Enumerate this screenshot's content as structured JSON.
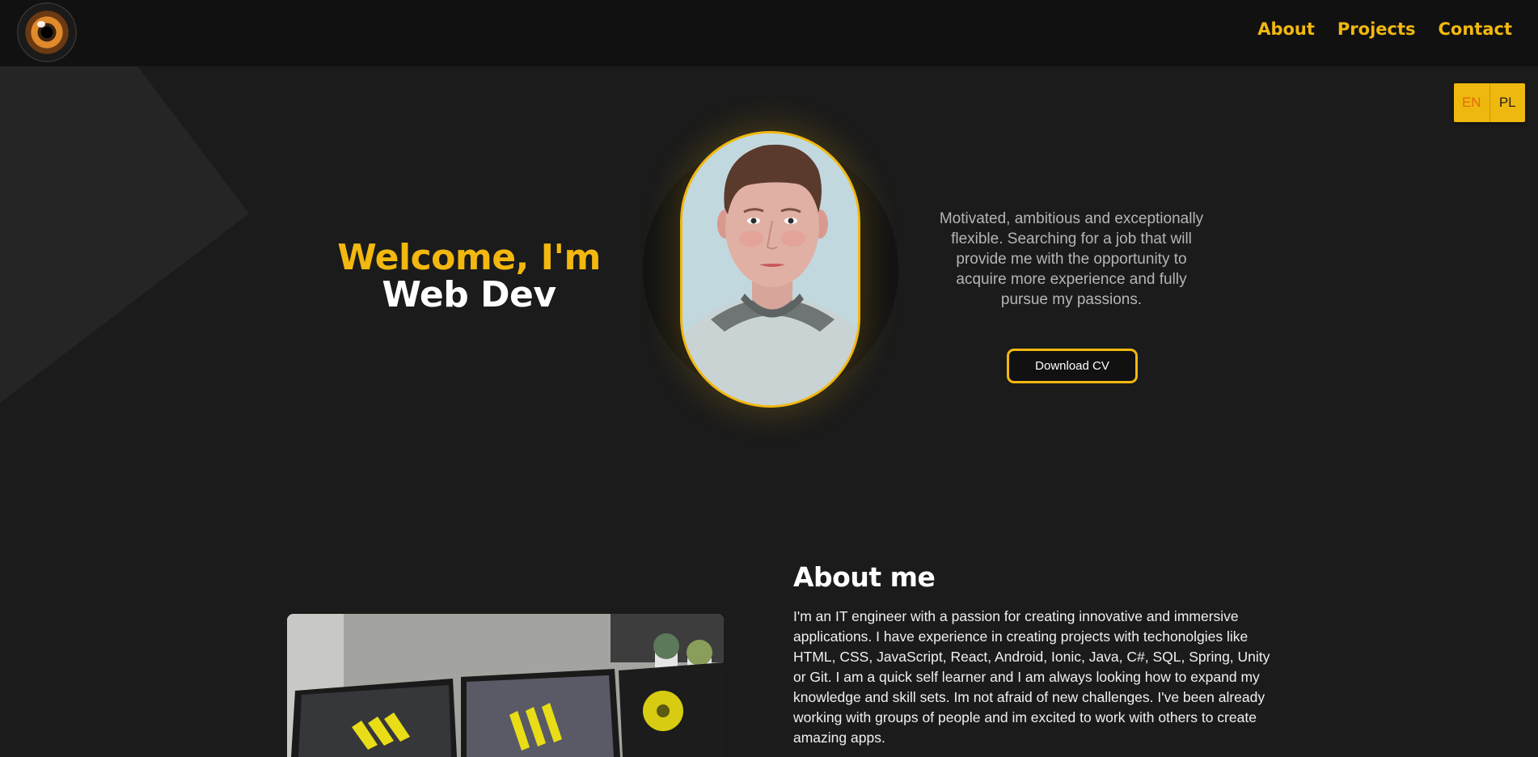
{
  "nav": {
    "items": [
      "About",
      "Projects",
      "Contact"
    ]
  },
  "lang": {
    "en": "EN",
    "pl": "PL"
  },
  "hero": {
    "line1": "Welcome, I'm",
    "line2": "Web Dev",
    "intro": "Motivated, ambitious and exceptionally flexible. Searching for a job that will provide me with the opportunity to acquire more experience and fully pursue my passions.",
    "cv_label": "Download CV"
  },
  "about": {
    "title": "About me",
    "text": "I'm an IT engineer with a passion for creating innovative and immersive applications. I have experience in creating projects with techonolgies like HTML, CSS, JavaScript, React, Android, Ionic, Java, C#, SQL, Spring, Unity or Git. I am a quick self learner and I am always looking how to expand my knowledge and skill sets. Im not afraid of new challenges. I've been already working with groups of people and im excited to work with others to create amazing apps."
  },
  "colors": {
    "accent": "#f2b80f",
    "background": "#1b1b1b",
    "header": "#111111"
  }
}
